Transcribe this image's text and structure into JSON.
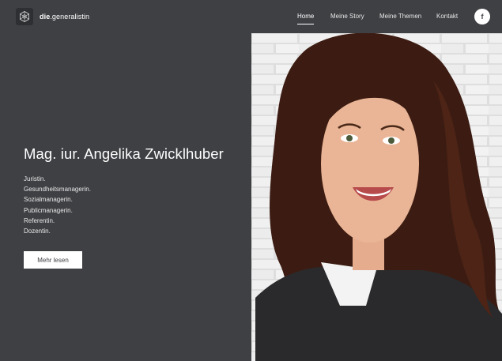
{
  "brand": {
    "prefix": "die",
    "suffix": ".generalistin"
  },
  "nav": [
    {
      "label": "Home",
      "active": true
    },
    {
      "label": "Meine Story",
      "active": false
    },
    {
      "label": "Meine Themen",
      "active": false
    },
    {
      "label": "Kontakt",
      "active": false
    }
  ],
  "social": {
    "facebook_label": "f"
  },
  "hero": {
    "title": "Mag. iur. Angelika Zwicklhuber",
    "roles": [
      "Juristin.",
      "Gesundheitsmanagerin.",
      "Sozialmanagerin.",
      "Publicmanagerin.",
      "Referentin.",
      "Dozentin."
    ],
    "cta_label": "Mehr lesen"
  },
  "colors": {
    "background": "#3f4044",
    "text": "#ffffff",
    "button_bg": "#ffffff",
    "button_text": "#3f4044"
  }
}
